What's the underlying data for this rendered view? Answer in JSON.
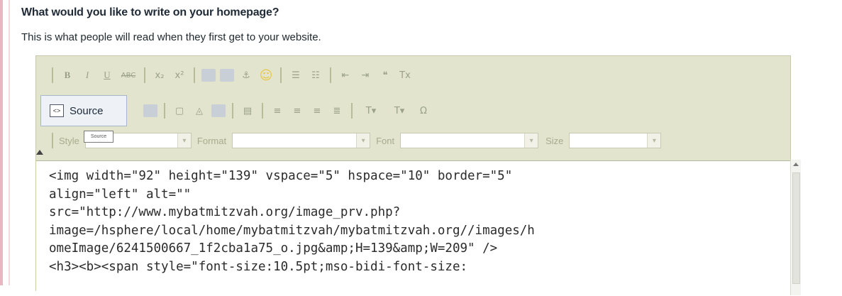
{
  "page": {
    "heading": "What would you like to write on your homepage?",
    "subheading": "This is what people will read when they first get to your website."
  },
  "toolbar": {
    "row1": [
      "B",
      "I",
      "U",
      "ABC",
      "x₂",
      "x²",
      "🔗",
      "⚑",
      "⚓",
      "☺",
      "☰",
      "☷",
      "⇤",
      "⇥",
      "❝",
      "Tx"
    ],
    "source_label": "Source",
    "source_tooltip": "Source",
    "row2_icons": [
      "save-icon",
      "new-page-icon",
      "preview-icon",
      "image-icon",
      "paste-icon",
      "align-left-icon",
      "align-center-icon",
      "align-right-icon",
      "justify-icon",
      "text-color-icon",
      "bg-color-icon",
      "special-char-icon"
    ],
    "style_label": "Style",
    "format_label": "Format",
    "font_label": "Font",
    "size_label": "Size"
  },
  "editor": {
    "source_lines": [
      "<img width=\"92\" height=\"139\" vspace=\"5\" hspace=\"10\" border=\"5\"",
      "align=\"left\" alt=\"\"",
      "src=\"http://www.mybatmitzvah.org/image_prv.php?",
      "image=/hsphere/local/home/mybatmitzvah/mybatmitzvah.org//images/h",
      "omeImage/6241500667_1f2cba1a75_o.jpg&amp;H=139&amp;W=209\" />",
      "<h3><b><span style=\"font-size:10.5pt;mso-bidi-font-size:"
    ]
  },
  "colors": {
    "toolbar_bg": "#e2e4cd",
    "source_button_bg": "#eef2f6",
    "page_border": "#e6b9c2"
  }
}
